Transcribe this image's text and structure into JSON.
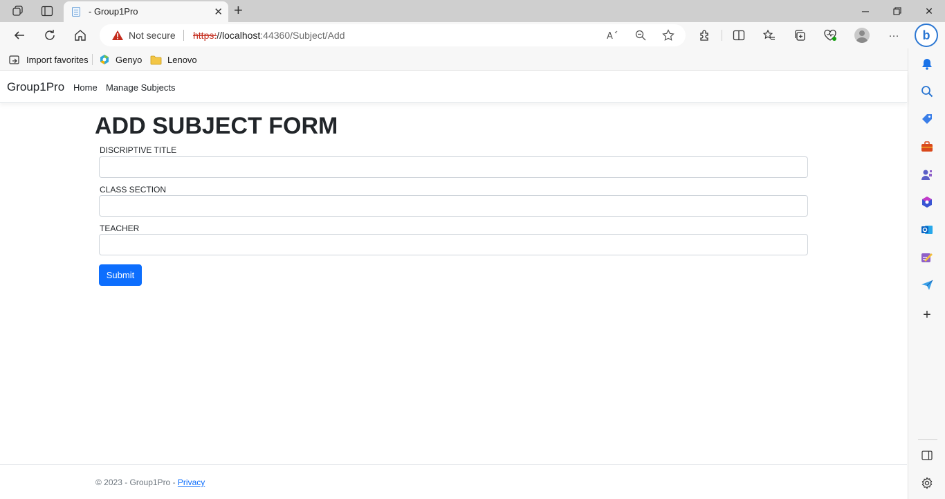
{
  "browser": {
    "tab": {
      "title": "- Group1Pro"
    },
    "address": {
      "security_label": "Not secure",
      "scheme": "https:",
      "host": "//localhost",
      "rest": ":44360/Subject/Add"
    },
    "bookmarks": [
      {
        "label": "Import favorites",
        "icon": "import-icon"
      },
      {
        "label": "Genyo",
        "icon": "genyo-icon"
      },
      {
        "label": "Lenovo",
        "icon": "folder-icon"
      }
    ]
  },
  "site": {
    "brand": "Group1Pro",
    "nav": [
      {
        "label": "Home"
      },
      {
        "label": "Manage Subjects"
      }
    ]
  },
  "form": {
    "title": "ADD SUBJECT FORM",
    "fields": [
      {
        "label": "DISCRIPTIVE TITLE",
        "value": ""
      },
      {
        "label": "CLASS SECTION",
        "value": ""
      },
      {
        "label": "TEACHER",
        "value": ""
      }
    ],
    "submit_label": "Submit",
    "accent": "#0d6efd"
  },
  "footer": {
    "text": "© 2023 - Group1Pro - ",
    "link": "Privacy"
  }
}
